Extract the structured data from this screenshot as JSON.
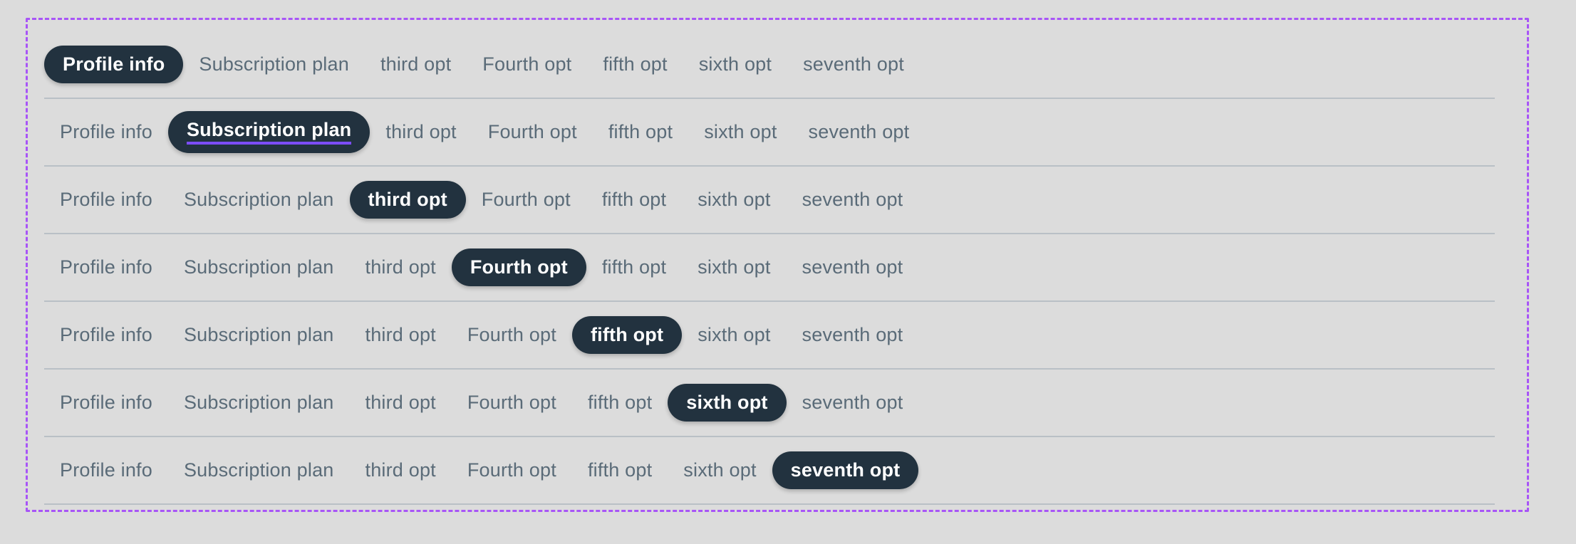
{
  "theme": {
    "page_background": "#dcdcdc",
    "active_pill_background": "#22323f",
    "active_pill_text": "#ffffff",
    "inactive_tab_text": "#5a6b78",
    "row_divider": "#b9c0c6",
    "dashed_frame": "#a855f7",
    "focus_underline": "#7c4dff"
  },
  "tabs": [
    "Profile info",
    "Subscription plan",
    "third opt",
    "Fourth opt",
    "fifth opt",
    "sixth opt",
    "seventh opt"
  ],
  "rows": [
    {
      "active_index": 0,
      "focused": false
    },
    {
      "active_index": 1,
      "focused": true
    },
    {
      "active_index": 2,
      "focused": false
    },
    {
      "active_index": 3,
      "focused": false
    },
    {
      "active_index": 4,
      "focused": false
    },
    {
      "active_index": 5,
      "focused": false
    },
    {
      "active_index": 6,
      "focused": false
    }
  ]
}
